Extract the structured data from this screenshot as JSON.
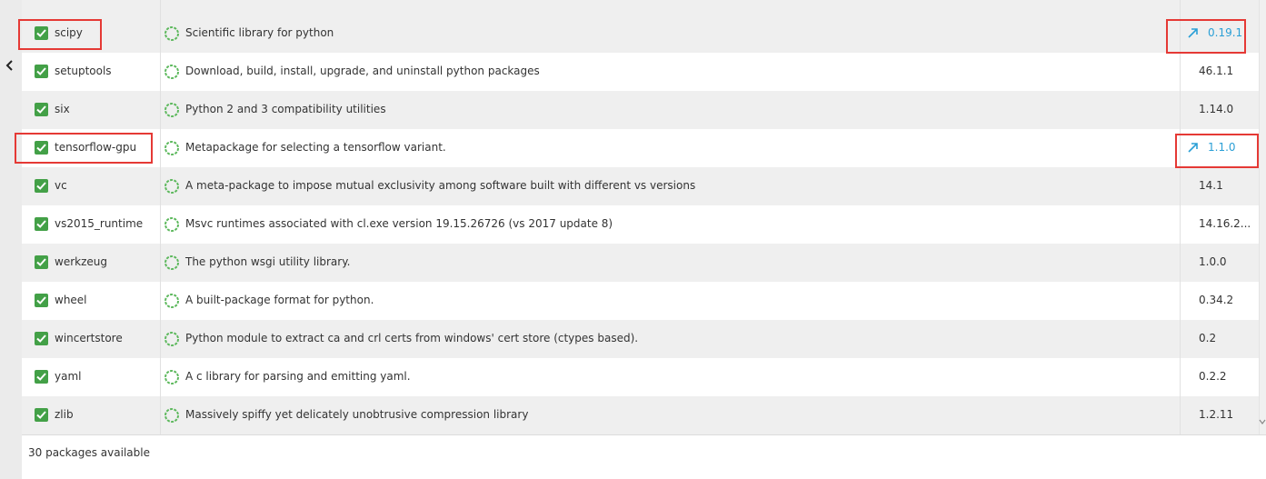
{
  "footer": {
    "status": "30 packages available"
  },
  "packages": [
    {
      "name": "scipy",
      "description": "Scientific library for python",
      "version": "0.19.1",
      "upgrade": true,
      "checked": true
    },
    {
      "name": "setuptools",
      "description": "Download, build, install, upgrade, and uninstall python packages",
      "version": "46.1.1",
      "upgrade": false,
      "checked": true
    },
    {
      "name": "six",
      "description": "Python 2 and 3 compatibility utilities",
      "version": "1.14.0",
      "upgrade": false,
      "checked": true
    },
    {
      "name": "tensorflow-gpu",
      "description": "Metapackage for selecting a tensorflow variant.",
      "version": "1.1.0",
      "upgrade": true,
      "checked": true
    },
    {
      "name": "vc",
      "description": "A meta-package to impose mutual exclusivity among software built with different vs versions",
      "version": "14.1",
      "upgrade": false,
      "checked": true
    },
    {
      "name": "vs2015_runtime",
      "description": "Msvc runtimes associated with cl.exe version 19.15.26726 (vs 2017 update 8)",
      "version": "14.16.2...",
      "upgrade": false,
      "checked": true
    },
    {
      "name": "werkzeug",
      "description": "The python wsgi utility library.",
      "version": "1.0.0",
      "upgrade": false,
      "checked": true
    },
    {
      "name": "wheel",
      "description": "A built-package format for python.",
      "version": "0.34.2",
      "upgrade": false,
      "checked": true
    },
    {
      "name": "wincertstore",
      "description": "Python module to extract ca and crl certs from windows' cert store (ctypes based).",
      "version": "0.2",
      "upgrade": false,
      "checked": true
    },
    {
      "name": "yaml",
      "description": "A c library for parsing and emitting yaml.",
      "version": "0.2.2",
      "upgrade": false,
      "checked": true
    },
    {
      "name": "zlib",
      "description": "Massively spiffy yet delicately unobtrusive compression library",
      "version": "1.2.11",
      "upgrade": false,
      "checked": true
    }
  ],
  "icons": {
    "checkbox": "checkbox-checked-icon",
    "status": "installed-status-icon",
    "upgrade": "upgrade-arrow-icon",
    "collapse": "chevron-left-icon",
    "scroll": "scroll-down-arrow-icon"
  },
  "colors": {
    "checkbox": "#43a047",
    "status_ring": "#5cb85c",
    "upgrade_link": "#2a9fd6",
    "highlight": "#e53935",
    "row_alt": "#efefef"
  }
}
